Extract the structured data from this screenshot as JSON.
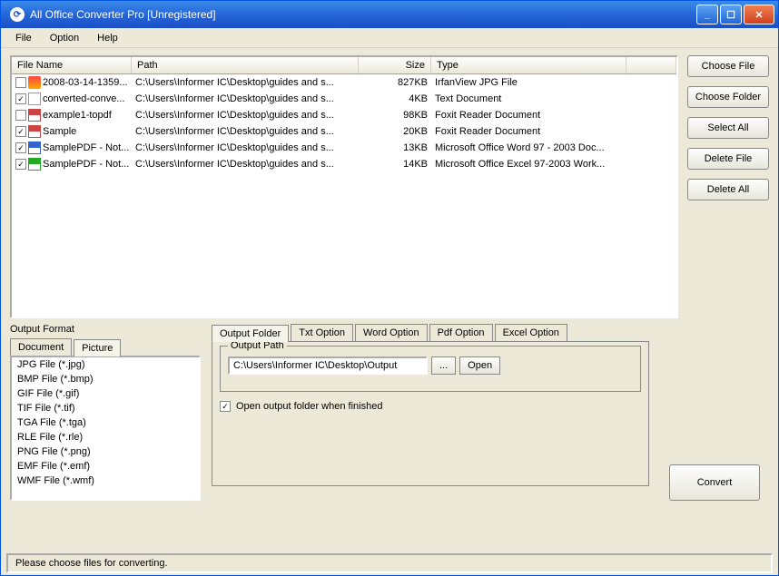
{
  "window": {
    "title": "All Office Converter Pro [Unregistered]"
  },
  "menu": {
    "file": "File",
    "option": "Option",
    "help": "Help"
  },
  "list": {
    "cols": {
      "name": "File Name",
      "path": "Path",
      "size": "Size",
      "type": "Type"
    },
    "rows": [
      {
        "checked": false,
        "icon": "fi-jpg",
        "name": "2008-03-14-1359...",
        "path": "C:\\Users\\Informer IC\\Desktop\\guides and s...",
        "size": "827KB",
        "type": "IrfanView JPG File"
      },
      {
        "checked": true,
        "icon": "fi-txt",
        "name": "converted-conve...",
        "path": "C:\\Users\\Informer IC\\Desktop\\guides and s...",
        "size": "4KB",
        "type": "Text Document"
      },
      {
        "checked": false,
        "icon": "fi-pdf",
        "name": "example1-topdf",
        "path": "C:\\Users\\Informer IC\\Desktop\\guides and s...",
        "size": "98KB",
        "type": "Foxit Reader Document"
      },
      {
        "checked": true,
        "icon": "fi-pdf",
        "name": "Sample",
        "path": "C:\\Users\\Informer IC\\Desktop\\guides and s...",
        "size": "20KB",
        "type": "Foxit Reader Document"
      },
      {
        "checked": true,
        "icon": "fi-doc",
        "name": "SamplePDF - Not...",
        "path": "C:\\Users\\Informer IC\\Desktop\\guides and s...",
        "size": "13KB",
        "type": "Microsoft Office Word 97 - 2003 Doc..."
      },
      {
        "checked": true,
        "icon": "fi-xls",
        "name": "SamplePDF - Not...",
        "path": "C:\\Users\\Informer IC\\Desktop\\guides and s...",
        "size": "14KB",
        "type": "Microsoft Office Excel 97-2003 Work..."
      }
    ]
  },
  "buttons": {
    "choose_file": "Choose File",
    "choose_folder": "Choose Folder",
    "select_all": "Select All",
    "delete_file": "Delete File",
    "delete_all": "Delete All",
    "convert": "Convert",
    "browse": "...",
    "open": "Open"
  },
  "output_format": {
    "label": "Output Format",
    "tabs": {
      "document": "Document",
      "picture": "Picture"
    },
    "items": [
      "JPG File  (*.jpg)",
      "BMP File  (*.bmp)",
      "GIF File  (*.gif)",
      "TIF File  (*.tif)",
      "TGA File  (*.tga)",
      "RLE File  (*.rle)",
      "PNG File  (*.png)",
      "EMF File  (*.emf)",
      "WMF File  (*.wmf)"
    ]
  },
  "options": {
    "tabs": {
      "output_folder": "Output Folder",
      "txt": "Txt Option",
      "word": "Word Option",
      "pdf": "Pdf Option",
      "excel": "Excel Option"
    },
    "output_path_label": "Output Path",
    "output_path": "C:\\Users\\Informer IC\\Desktop\\Output",
    "open_when_finished": "Open output folder when finished",
    "open_when_finished_checked": true
  },
  "status": "Please choose files for converting."
}
